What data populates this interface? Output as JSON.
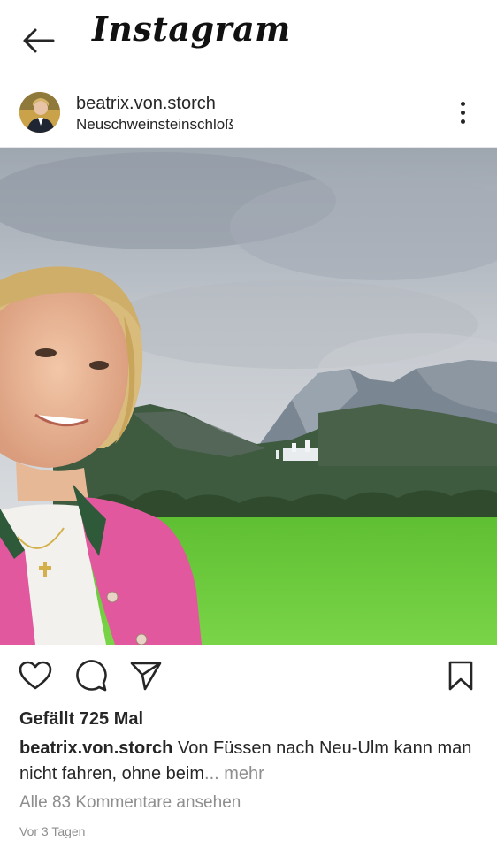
{
  "app": {
    "title": "Instagram"
  },
  "post": {
    "username": "beatrix.von.storch",
    "location": "Neuschweinsteinschloß",
    "likes_text": "Gefällt 725 Mal",
    "caption_user": "beatrix.von.storch",
    "caption_text": "Von Füssen nach Neu-Ulm kann man nicht fahren, ohne beim",
    "caption_ellipsis": "...",
    "caption_more": "mehr",
    "comments_link": "Alle 83 Kommentare ansehen",
    "timestamp": "Vor 3 Tagen"
  },
  "icons": {
    "back": "arrow-left-icon",
    "more": "more-vertical-icon",
    "like": "heart-icon",
    "comment": "comment-icon",
    "share": "send-icon",
    "save": "bookmark-icon"
  },
  "colors": {
    "text": "#262626",
    "muted": "#8e8e8e",
    "jacket_pink": "#e05aa0",
    "grass": "#6fcf3a",
    "sky": "#b9c0c8"
  }
}
